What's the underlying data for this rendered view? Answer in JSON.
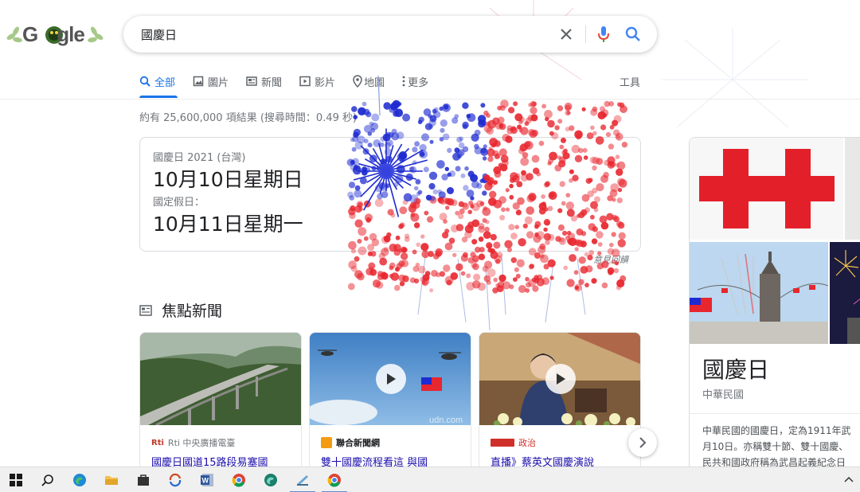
{
  "logo": {
    "text_g": "G",
    "text_rest": "gle"
  },
  "search": {
    "query": "國慶日"
  },
  "tabs": [
    {
      "label": "全部",
      "icon": "search-icon"
    },
    {
      "label": "圖片",
      "icon": "image-icon"
    },
    {
      "label": "新聞",
      "icon": "newspaper-icon"
    },
    {
      "label": "影片",
      "icon": "video-icon"
    },
    {
      "label": "地圖",
      "icon": "map-pin-icon"
    },
    {
      "label": "更多",
      "icon": "more-vert-icon"
    }
  ],
  "tools_label": "工具",
  "result_stats": "約有 25,600,000 項結果 (搜尋時間：0.49 秒)",
  "date_card": {
    "line1": "國慶日 2021 (台灣)",
    "date1": "10月10日星期日",
    "line2": "國定假日：",
    "date2": "10月11日星期一"
  },
  "feedback": "意見回饋",
  "news": {
    "heading": "焦點新聞",
    "cards": [
      {
        "source": "Rti 中央廣播電臺",
        "title": "國慶日國道15路段易塞國"
      },
      {
        "source": "聯合新聞網",
        "title": "雙十國慶流程看這 與國"
      },
      {
        "source": "政治",
        "title": "直播》蔡英文國慶演說"
      }
    ],
    "watermark": "udn.com"
  },
  "knowledge_panel": {
    "title": "國慶日",
    "subtitle": "中華民國",
    "desc_lines": [
      "中華民國的國慶日，定為1911年武",
      "月10日。亦稱雙十節、雙十國慶、",
      "民共和國政府稱為武昌起義紀念日"
    ]
  },
  "colors": {
    "accent": "#1a73e8",
    "link": "#1a0dab",
    "flag_red": "#e8262e",
    "flag_blue": "#1e2bd0"
  }
}
